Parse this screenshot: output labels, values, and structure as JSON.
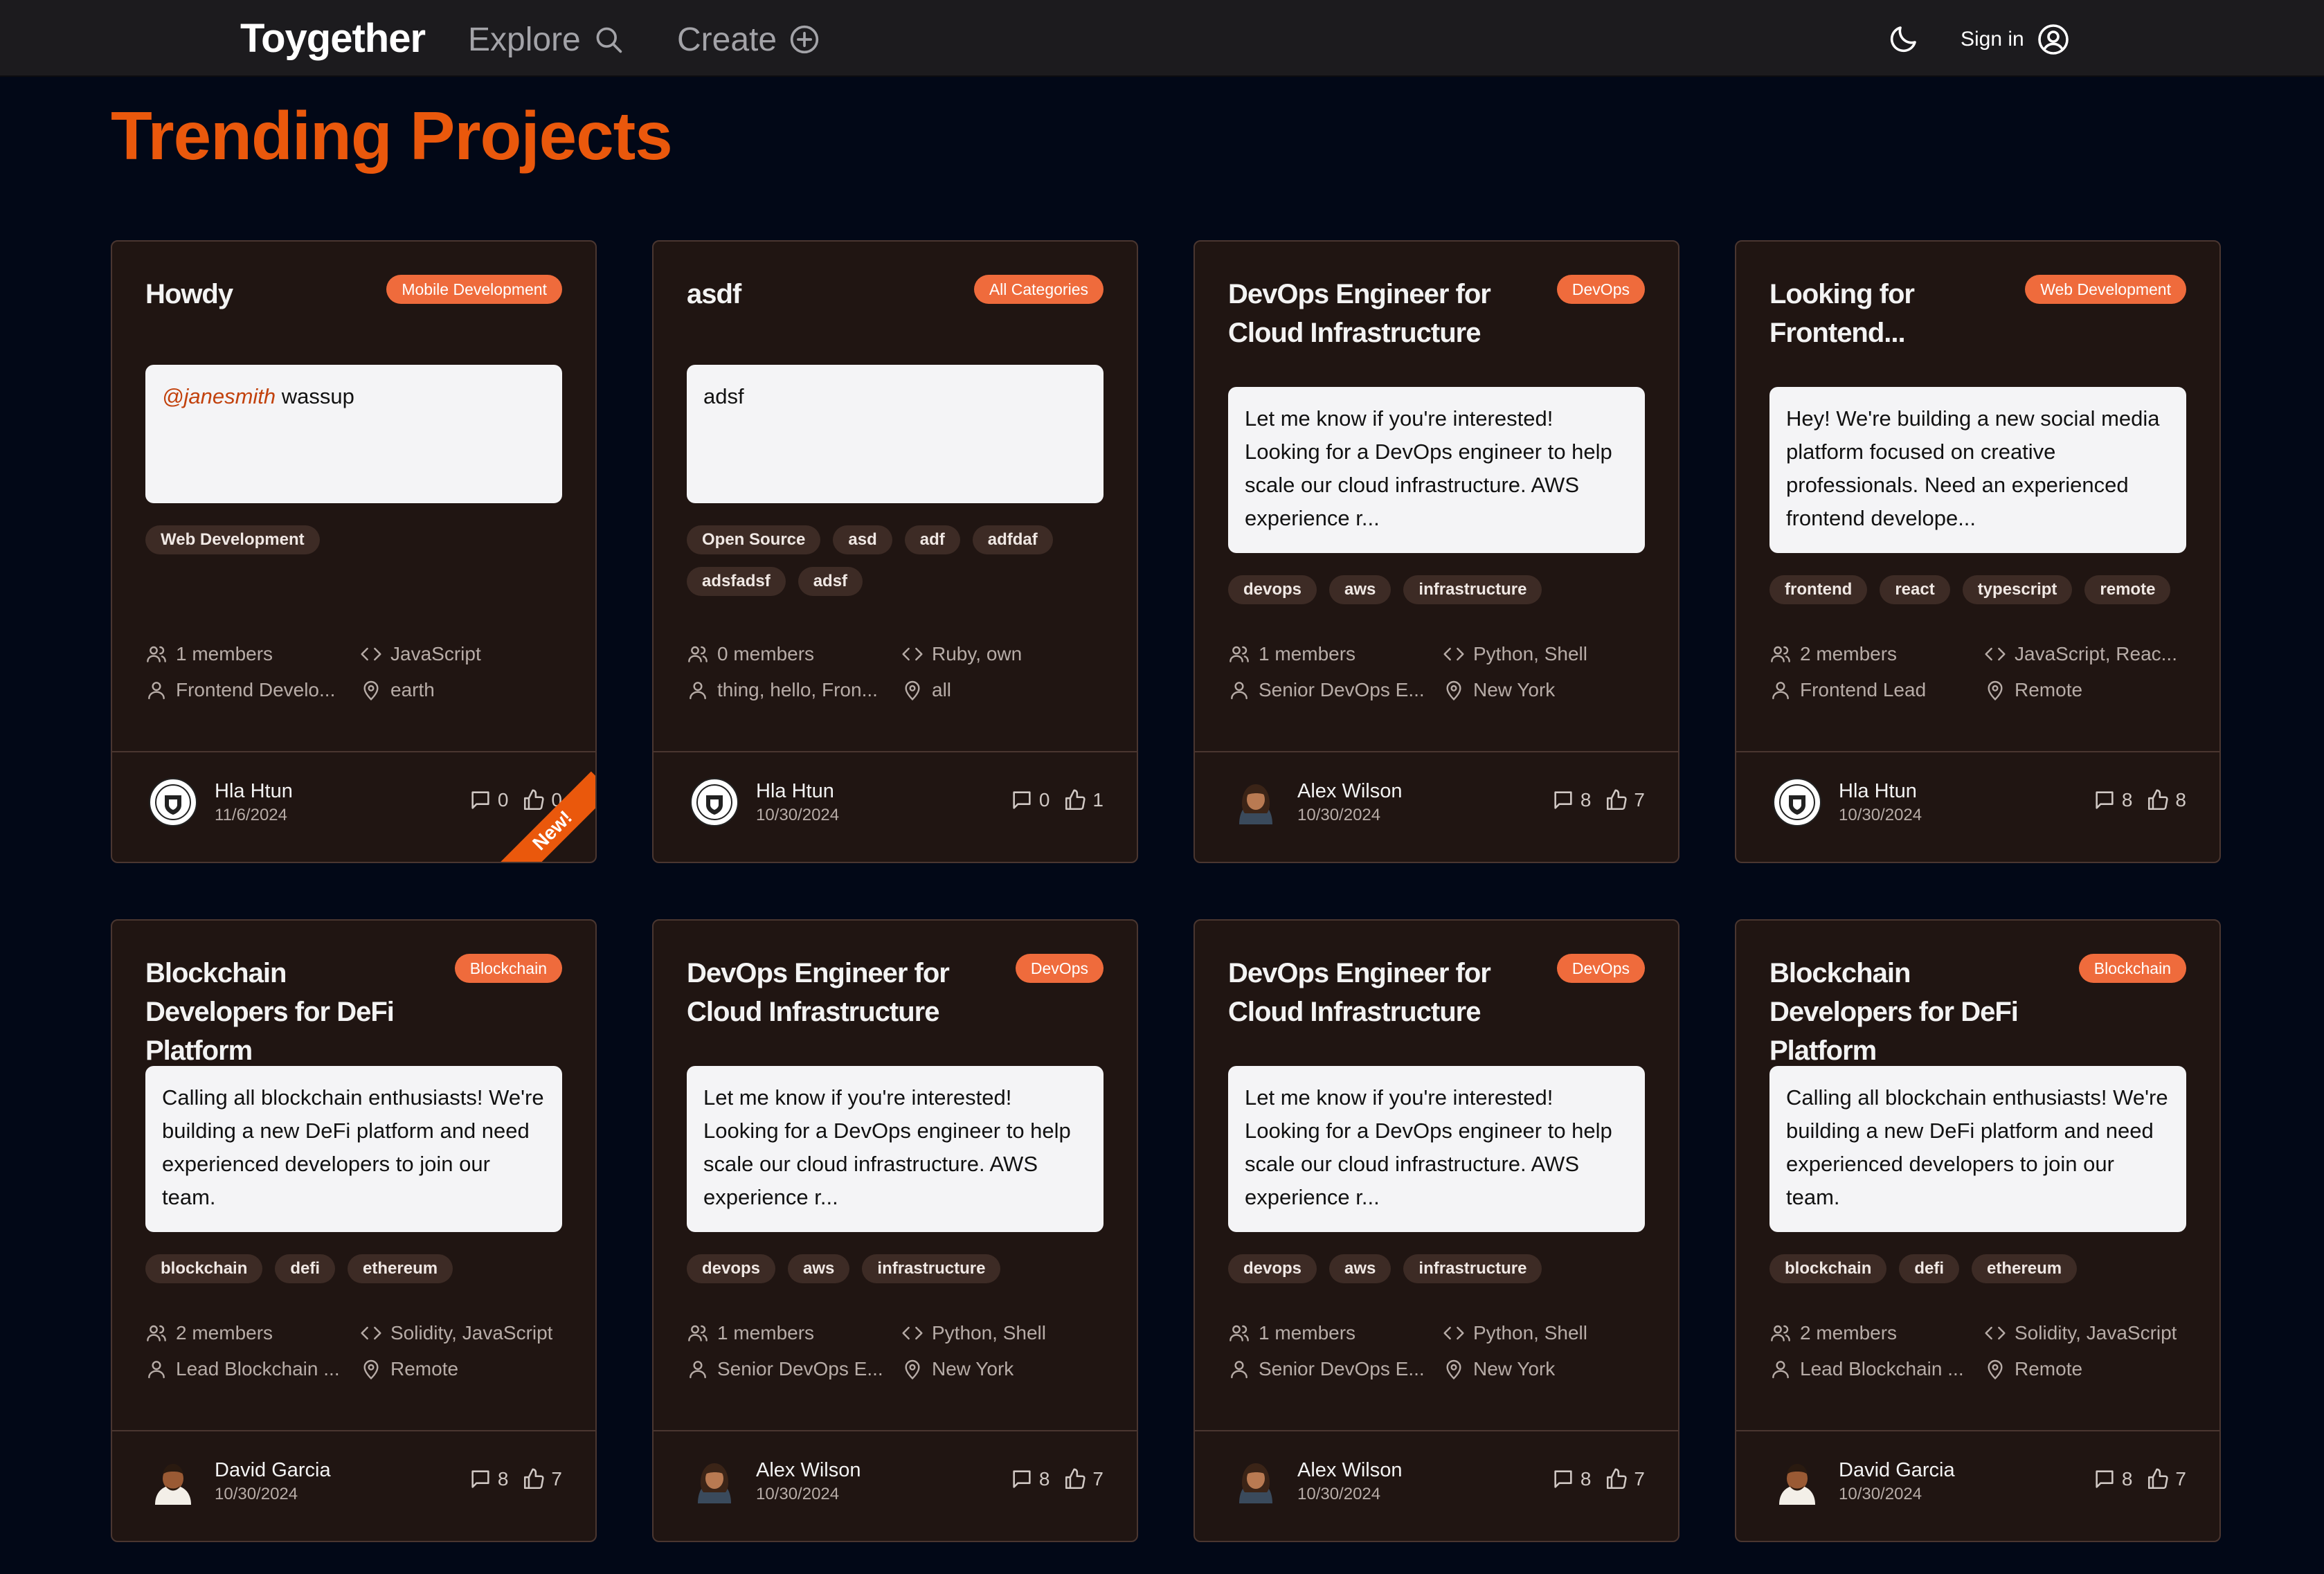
{
  "header": {
    "brand": "Toygether",
    "explore_label": "Explore",
    "create_label": "Create",
    "signin_label": "Sign in"
  },
  "page": {
    "title": "Trending Projects"
  },
  "icons": {
    "search": "search-icon",
    "create": "plus-circle-icon",
    "theme": "moon-icon",
    "user": "user-circle-icon",
    "members": "users-icon",
    "code": "code-icon",
    "role": "user-icon",
    "location": "map-pin-icon",
    "comments": "message-square-icon",
    "likes": "thumbs-up-icon"
  },
  "colors": {
    "accent": "#ea580c",
    "background": "#020817",
    "card": "#201512"
  },
  "projects": [
    {
      "title": "Howdy",
      "category": "Mobile Development",
      "mention": "@janesmith",
      "description": "wassup",
      "tags": [
        "Web Development"
      ],
      "members": "1 members",
      "languages": "JavaScript",
      "role": "Frontend Develo...",
      "location": "earth",
      "author": "Hla Htun",
      "date": "11/6/2024",
      "comments": "0",
      "likes": "0",
      "ribbon": "New!"
    },
    {
      "title": "asdf",
      "category": "All Categories",
      "description": "adsf",
      "tags": [
        "Open Source",
        "asd",
        "adf",
        "adfdaf",
        "adsfadsf",
        "adsf"
      ],
      "members": "0 members",
      "languages": "Ruby, own",
      "role": "thing, hello, Fron...",
      "location": "all",
      "author": "Hla Htun",
      "date": "10/30/2024",
      "comments": "0",
      "likes": "1"
    },
    {
      "title": "DevOps Engineer for Cloud Infrastructure",
      "category": "DevOps",
      "description": "Let me know if you're interested! Looking for a DevOps engineer to help scale our cloud infrastructure. AWS experience r...",
      "tags": [
        "devops",
        "aws",
        "infrastructure"
      ],
      "members": "1 members",
      "languages": "Python, Shell",
      "role": "Senior DevOps E...",
      "location": "New York",
      "author": "Alex Wilson",
      "date": "10/30/2024",
      "comments": "8",
      "likes": "7"
    },
    {
      "title": "Looking for Frontend...",
      "category": "Web Development",
      "description": "Hey! We're building a new social media platform focused on creative professionals. Need an experienced frontend develope...",
      "tags": [
        "frontend",
        "react",
        "typescript",
        "remote"
      ],
      "members": "2 members",
      "languages": "JavaScript, Reac...",
      "role": "Frontend Lead",
      "location": "Remote",
      "author": "Hla Htun",
      "date": "10/30/2024",
      "comments": "8",
      "likes": "8"
    },
    {
      "title": "Blockchain Developers for DeFi Platform",
      "category": "Blockchain",
      "description": "Calling all blockchain enthusiasts! We're building a new DeFi platform and need experienced developers to join our team.",
      "tags": [
        "blockchain",
        "defi",
        "ethereum"
      ],
      "members": "2 members",
      "languages": "Solidity, JavaScript",
      "role": "Lead Blockchain ...",
      "location": "Remote",
      "author": "David Garcia",
      "date": "10/30/2024",
      "comments": "8",
      "likes": "7"
    },
    {
      "title": "DevOps Engineer for Cloud Infrastructure",
      "category": "DevOps",
      "description": "Let me know if you're interested! Looking for a DevOps engineer to help scale our cloud infrastructure. AWS experience r...",
      "tags": [
        "devops",
        "aws",
        "infrastructure"
      ],
      "members": "1 members",
      "languages": "Python, Shell",
      "role": "Senior DevOps E...",
      "location": "New York",
      "author": "Alex Wilson",
      "date": "10/30/2024",
      "comments": "8",
      "likes": "7"
    },
    {
      "title": "DevOps Engineer for Cloud Infrastructure",
      "category": "DevOps",
      "description": "Let me know if you're interested! Looking for a DevOps engineer to help scale our cloud infrastructure. AWS experience r...",
      "tags": [
        "devops",
        "aws",
        "infrastructure"
      ],
      "members": "1 members",
      "languages": "Python, Shell",
      "role": "Senior DevOps E...",
      "location": "New York",
      "author": "Alex Wilson",
      "date": "10/30/2024",
      "comments": "8",
      "likes": "7"
    },
    {
      "title": "Blockchain Developers for DeFi Platform",
      "category": "Blockchain",
      "description": "Calling all blockchain enthusiasts! We're building a new DeFi platform and need experienced developers to join our team.",
      "tags": [
        "blockchain",
        "defi",
        "ethereum"
      ],
      "members": "2 members",
      "languages": "Solidity, JavaScript",
      "role": "Lead Blockchain ...",
      "location": "Remote",
      "author": "David Garcia",
      "date": "10/30/2024",
      "comments": "8",
      "likes": "7"
    }
  ]
}
